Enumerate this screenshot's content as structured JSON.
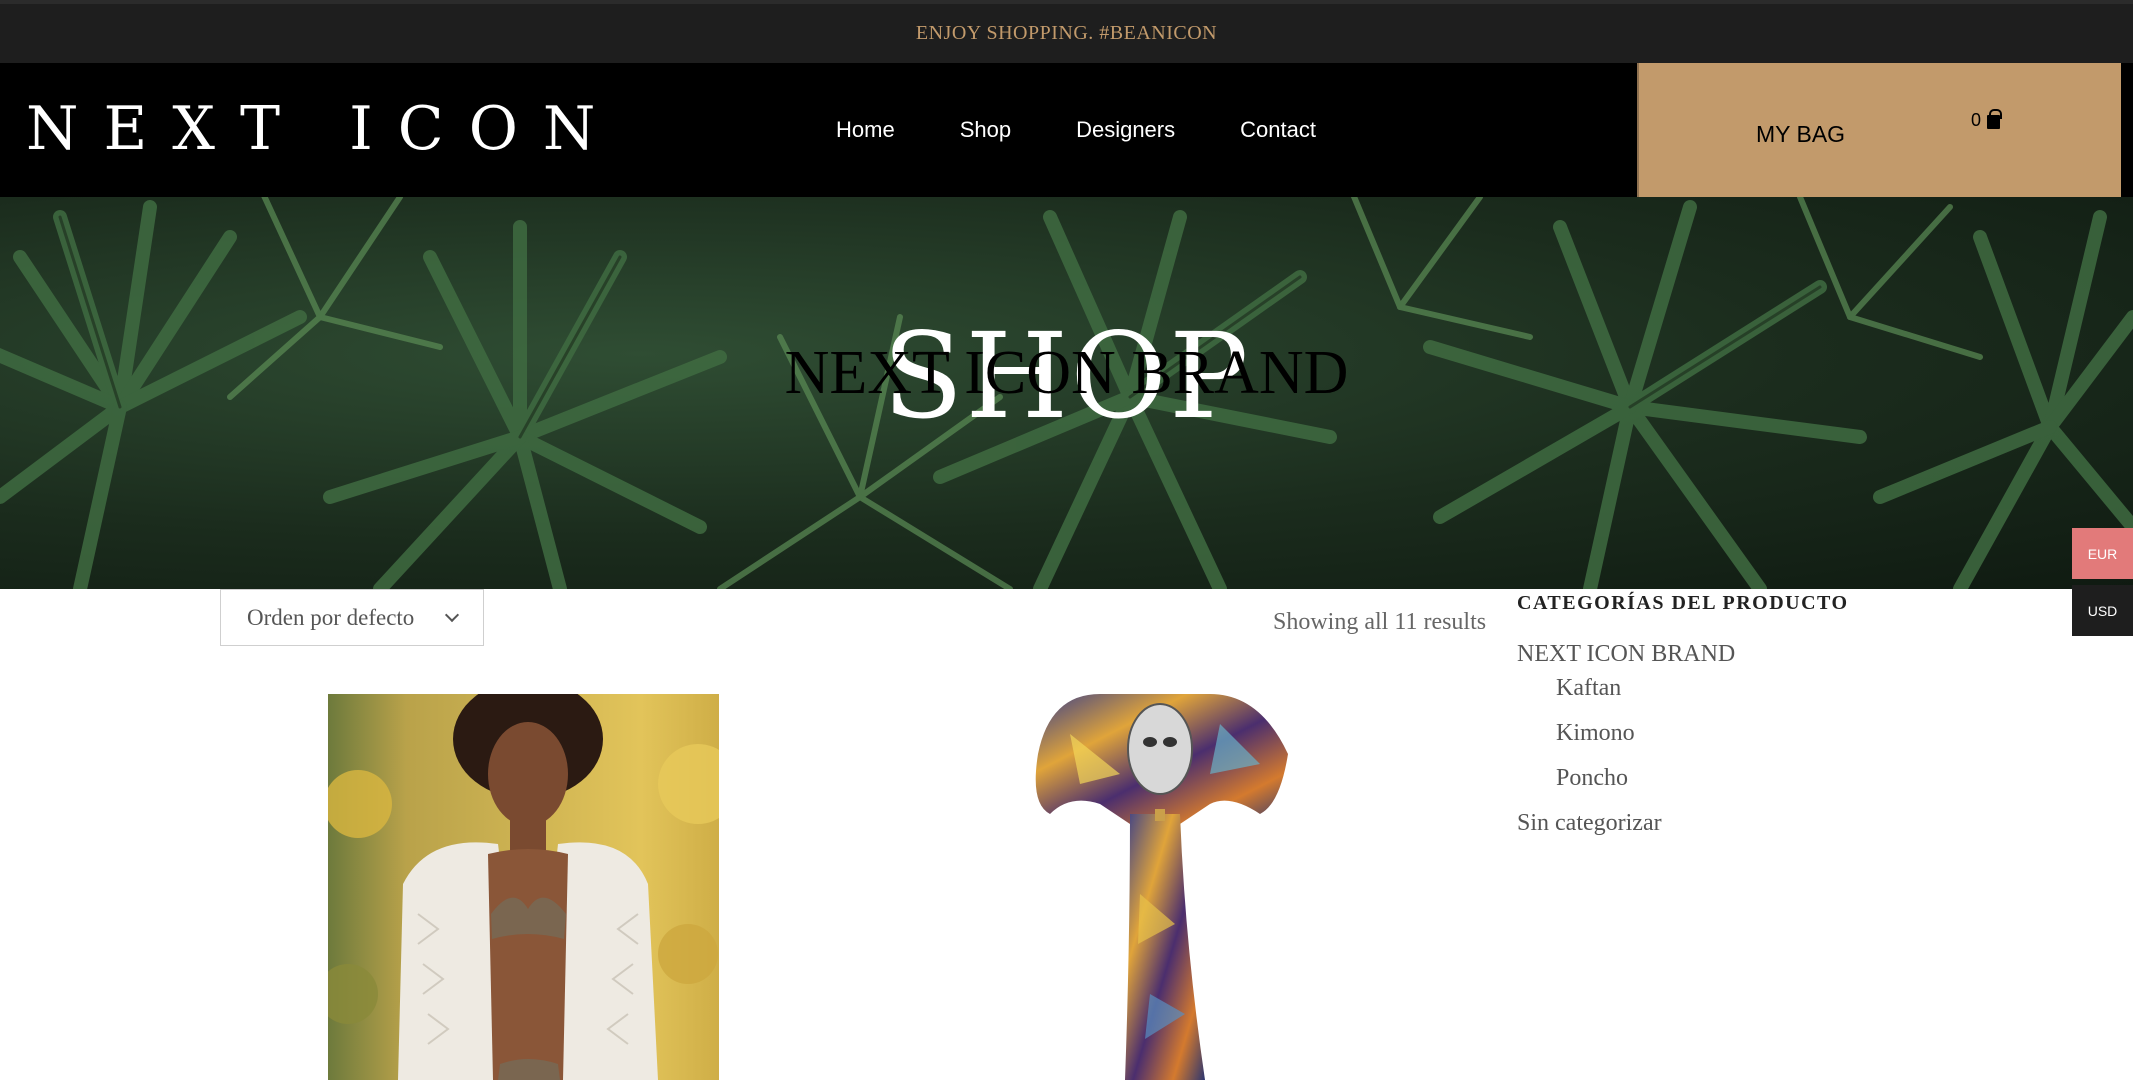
{
  "announcement": "ENJOY SHOPPING. #BEANICON",
  "brand": {
    "logo": "NEXT ICON"
  },
  "nav": {
    "items": [
      "Home",
      "Shop",
      "Designers",
      "Contact"
    ]
  },
  "cart": {
    "label": "MY BAG",
    "count": "0"
  },
  "hero": {
    "title": "SHOP",
    "subtitle": "NEXT ICON BRAND"
  },
  "shop": {
    "sort_label": "Orden por defecto",
    "results_text": "Showing all 11 results"
  },
  "categories": {
    "title": "CATEGORÍAS DEL PRODUCTO",
    "items": [
      "NEXT ICON BRAND",
      "Kaftan",
      "Kimono",
      "Poncho",
      "Sin categorizar"
    ]
  },
  "currency": {
    "options": [
      "EUR",
      "USD"
    ],
    "selected": "EUR"
  },
  "colors": {
    "accent": "#c29a6b",
    "eur": "#e27a7a",
    "topbar": "#1e1e1e"
  }
}
